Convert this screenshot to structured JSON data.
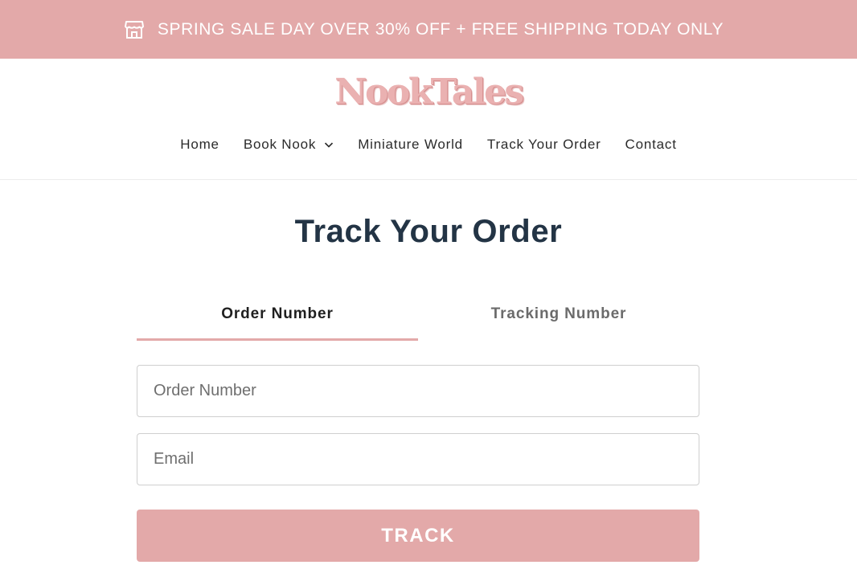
{
  "announcement": {
    "icon": "store-icon",
    "text": "SPRING SALE DAY OVER 30% OFF + FREE SHIPPING TODAY ONLY"
  },
  "logo": {
    "text": "NookTales"
  },
  "nav": {
    "items": [
      {
        "label": "Home"
      },
      {
        "label": "Book Nook",
        "has_dropdown": true
      },
      {
        "label": "Miniature World"
      },
      {
        "label": "Track Your Order"
      },
      {
        "label": "Contact"
      }
    ]
  },
  "page": {
    "title": "Track Your Order",
    "tabs": [
      {
        "label": "Order Number",
        "active": true
      },
      {
        "label": "Tracking Number",
        "active": false
      }
    ],
    "form": {
      "order_number_placeholder": "Order Number",
      "email_placeholder": "Email",
      "submit_label": "TRACK"
    }
  },
  "colors": {
    "accent": "#e3a9a9",
    "title": "#233445"
  }
}
